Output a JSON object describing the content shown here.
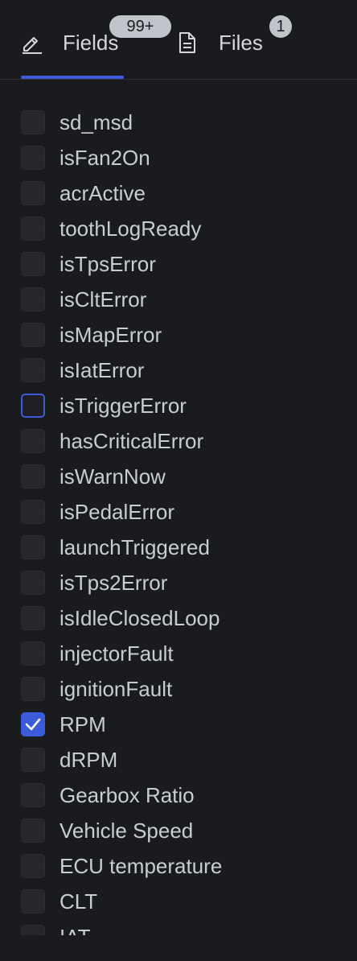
{
  "tabs": [
    {
      "label": "Fields",
      "badge": "99+",
      "icon": "pencil-icon",
      "active": true
    },
    {
      "label": "Files",
      "badge": "1",
      "icon": "document-icon",
      "active": false
    }
  ],
  "colors": {
    "accent": "#3b5bdb",
    "background": "#1a1b1e",
    "checkbox_bg": "#26272c",
    "text": "#c9ccd3"
  },
  "fields": [
    {
      "label": "sd_msd",
      "checked": false
    },
    {
      "label": "isFan2On",
      "checked": false
    },
    {
      "label": "acrActive",
      "checked": false
    },
    {
      "label": "toothLogReady",
      "checked": false
    },
    {
      "label": "isTpsError",
      "checked": false
    },
    {
      "label": "isCltError",
      "checked": false
    },
    {
      "label": "isMapError",
      "checked": false
    },
    {
      "label": "isIatError",
      "checked": false
    },
    {
      "label": "isTriggerError",
      "checked": false,
      "focused": true
    },
    {
      "label": "hasCriticalError",
      "checked": false
    },
    {
      "label": "isWarnNow",
      "checked": false
    },
    {
      "label": "isPedalError",
      "checked": false
    },
    {
      "label": "launchTriggered",
      "checked": false
    },
    {
      "label": "isTps2Error",
      "checked": false
    },
    {
      "label": "isIdleClosedLoop",
      "checked": false
    },
    {
      "label": "injectorFault",
      "checked": false
    },
    {
      "label": "ignitionFault",
      "checked": false
    },
    {
      "label": "RPM",
      "checked": true
    },
    {
      "label": "dRPM",
      "checked": false
    },
    {
      "label": "Gearbox Ratio",
      "checked": false
    },
    {
      "label": "Vehicle Speed",
      "checked": false
    },
    {
      "label": "ECU temperature",
      "checked": false
    },
    {
      "label": "CLT",
      "checked": false
    },
    {
      "label": "IAT",
      "checked": false
    }
  ]
}
